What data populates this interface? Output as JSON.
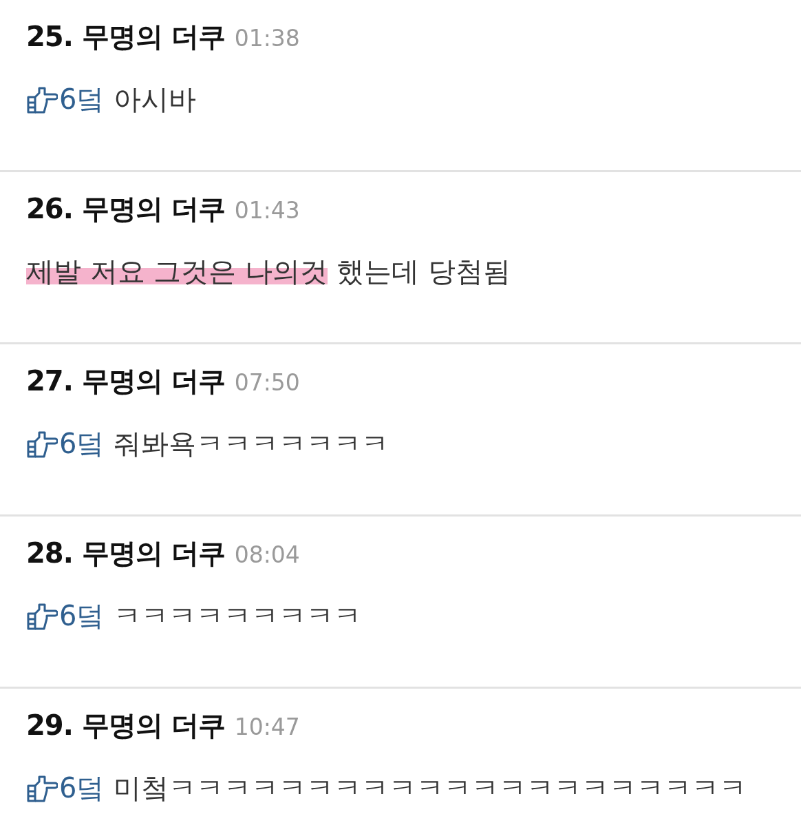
{
  "comments": [
    {
      "number": "25.",
      "author": "무명의 더쿠",
      "time": "01:38",
      "kind": "liked",
      "likes": "6덬",
      "body": [
        {
          "text": "아시바",
          "highlighted": false
        }
      ]
    },
    {
      "number": "26.",
      "author": "무명의 더쿠",
      "time": "01:43",
      "kind": "plain",
      "body": [
        {
          "text": "제발 저요 그것은 나의것",
          "highlighted": true
        },
        {
          "text": " 했는데 당첨됨",
          "highlighted": false
        }
      ]
    },
    {
      "number": "27.",
      "author": "무명의 더쿠",
      "time": "07:50",
      "kind": "liked",
      "likes": "6덬",
      "body": [
        {
          "text": "줘봐욕ㅋㅋㅋㅋㅋㅋㅋ",
          "highlighted": false
        }
      ]
    },
    {
      "number": "28.",
      "author": "무명의 더쿠",
      "time": "08:04",
      "kind": "liked",
      "likes": "6덬",
      "body": [
        {
          "text": "ㅋㅋㅋㅋㅋㅋㅋㅋㅋ",
          "highlighted": false
        }
      ]
    },
    {
      "number": "29.",
      "author": "무명의 더쿠",
      "time": "10:47",
      "kind": "liked",
      "likes": "6덬",
      "body": [
        {
          "text": "미첰ㅋㅋㅋㅋㅋㅋㅋㅋㅋㅋㅋㅋㅋㅋㅋㅋㅋㅋㅋㅋㅋ",
          "highlighted": false
        }
      ]
    }
  ]
}
